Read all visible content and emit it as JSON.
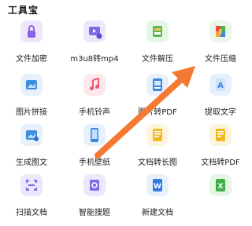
{
  "section": {
    "title": "工具宝"
  },
  "tools": [
    {
      "label": "文件加密",
      "icon": "lock-icon",
      "bg": "#efe6fb",
      "fg": "#8b63e6"
    },
    {
      "label": "m3u8转mp4",
      "icon": "video-convert-icon",
      "bg": "#ece7fb",
      "fg": "#7b6be8"
    },
    {
      "label": "文件解压",
      "icon": "archive-open-icon",
      "bg": "#e5f6e4",
      "fg": "#58b85a"
    },
    {
      "label": "文件压缩",
      "icon": "archive-compress-icon",
      "bg": "#eaf6e8",
      "fg": "#4caf50"
    },
    {
      "label": "图片拼接",
      "icon": "image-stitch-icon",
      "bg": "#e6f1fc",
      "fg": "#3f8fe0"
    },
    {
      "label": "手机铃声",
      "icon": "music-note-icon",
      "bg": "#fde9ec",
      "fg": "#ea5a72"
    },
    {
      "label": "图片转PDF",
      "icon": "image-to-pdf-icon",
      "bg": "#e6f1fc",
      "fg": "#3a86dd"
    },
    {
      "label": "提取文字",
      "icon": "extract-text-icon",
      "bg": "#e6f1fc",
      "fg": "#3a86dd"
    },
    {
      "label": "生成图文",
      "icon": "generate-image-text-icon",
      "bg": "#e6f1fc",
      "fg": "#3f8fe0"
    },
    {
      "label": "手机壁纸",
      "icon": "phone-wallpaper-icon",
      "bg": "#e6f1fc",
      "fg": "#3a86dd"
    },
    {
      "label": "文档转长图",
      "icon": "doc-to-long-image-icon",
      "bg": "#fdf4dc",
      "fg": "#f2b81f"
    },
    {
      "label": "文档转PDF",
      "icon": "doc-to-pdf-icon",
      "bg": "#fdf4dc",
      "fg": "#f2b81f"
    },
    {
      "label": "扫描文档",
      "icon": "scan-document-icon",
      "bg": "#ece7fb",
      "fg": "#7b6be8"
    },
    {
      "label": "智能搜题",
      "icon": "smart-search-icon",
      "bg": "#ece7fb",
      "fg": "#7b6be8"
    },
    {
      "label": "新建文档",
      "icon": "word-doc-icon",
      "bg": "#e6f1fc",
      "fg": "#2f7de1"
    },
    {
      "label": "",
      "icon": "excel-doc-icon",
      "bg": "#e5f6e4",
      "fg": "#3fae4a"
    }
  ],
  "annotation": {
    "arrow_color": "#f47a33"
  }
}
